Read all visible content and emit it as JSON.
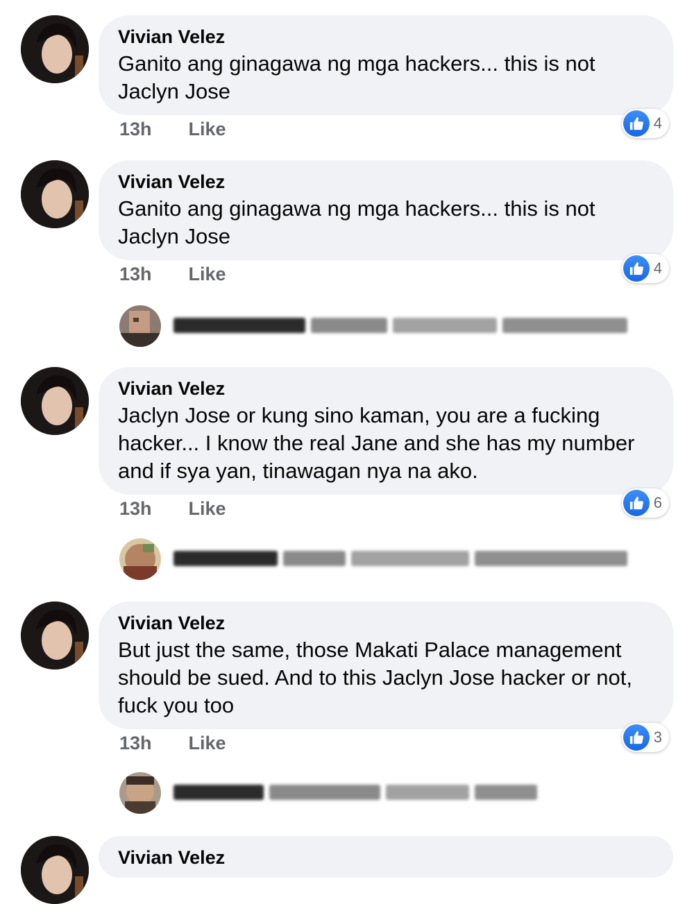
{
  "comments": [
    {
      "author": "Vivian Velez",
      "text": "Ganito ang ginagawa ng mga hackers... this is not Jaclyn Jose",
      "time": "13h",
      "like_label": "Like",
      "reaction_count": "4"
    },
    {
      "author": "Vivian Velez",
      "text": "Ganito ang ginagawa ng mga hackers... this is not Jaclyn Jose",
      "time": "13h",
      "like_label": "Like",
      "reaction_count": "4"
    },
    {
      "author": "Vivian Velez",
      "text": "Jaclyn Jose or kung sino kaman, you are a fucking hacker... I know the real Jane and she has my number and if sya yan, tinawagan nya na ako.",
      "time": "13h",
      "like_label": "Like",
      "reaction_count": "6"
    },
    {
      "author": "Vivian Velez",
      "text": "But just the same, those Makati Palace management should be sued. And to this Jaclyn Jose hacker or not, fuck you too",
      "time": "13h",
      "like_label": "Like",
      "reaction_count": "3"
    },
    {
      "author": "Vivian Velez"
    }
  ],
  "colors": {
    "bubble": "#f0f2f5",
    "meta": "#65676b",
    "like_blue": "#1877f2"
  },
  "icons": {
    "reaction": "thumbs-up-icon"
  }
}
